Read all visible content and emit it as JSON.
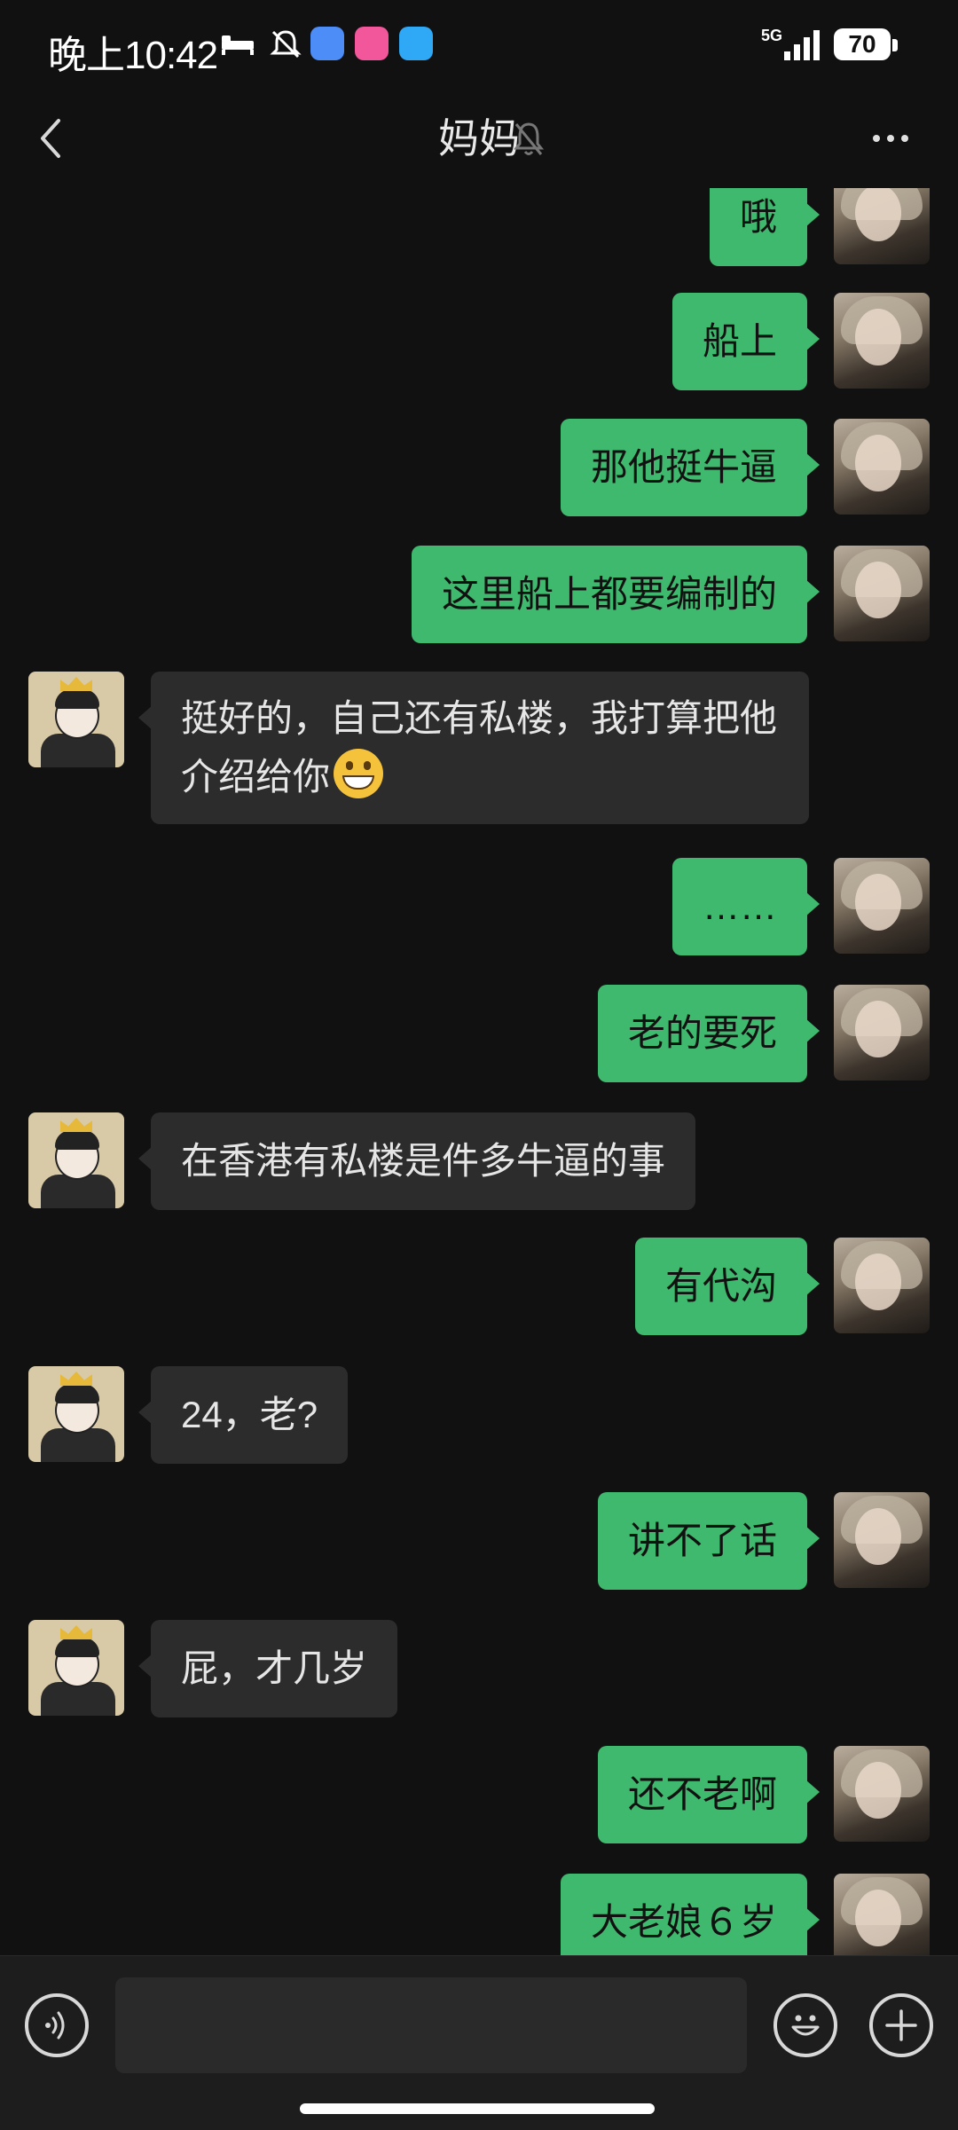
{
  "status_bar": {
    "time": "晚上10:42",
    "network": "5G",
    "battery": "70",
    "icons": [
      "sleep-icon",
      "mute-icon",
      "baidu-app-icon",
      "bilibili-app-icon",
      "cloud-app-icon",
      "signal-icon",
      "battery-icon"
    ]
  },
  "header": {
    "title": "妈妈",
    "back_icon": "chevron-left-icon",
    "mute_icon": "bell-muted-icon",
    "more_icon": "more-dots-icon"
  },
  "messages": [
    {
      "sender": "me",
      "text": "哦"
    },
    {
      "sender": "me",
      "text": "船上"
    },
    {
      "sender": "me",
      "text": "那他挺牛逼"
    },
    {
      "sender": "me",
      "text": "这里船上都要编制的"
    },
    {
      "sender": "mom",
      "text": "挺好的，自己还有私楼，我打算把他介绍给你",
      "emoji": "grinning-face-emoji"
    },
    {
      "sender": "me",
      "text": "……"
    },
    {
      "sender": "me",
      "text": "老的要死"
    },
    {
      "sender": "mom",
      "text": "在香港有私楼是件多牛逼的事"
    },
    {
      "sender": "me",
      "text": "有代沟"
    },
    {
      "sender": "mom",
      "text": "24，老?"
    },
    {
      "sender": "me",
      "text": "讲不了话"
    },
    {
      "sender": "mom",
      "text": "屁，才几岁"
    },
    {
      "sender": "me",
      "text": "还不老啊"
    },
    {
      "sender": "me",
      "text": "大老娘６岁"
    }
  ],
  "input_bar": {
    "voice_icon": "voice-icon",
    "input_value": "",
    "emoji_icon": "emoji-icon",
    "plus_icon": "plus-icon"
  },
  "colors": {
    "background": "#111111",
    "my_bubble": "#3fb96d",
    "other_bubble": "#2c2c2c"
  }
}
